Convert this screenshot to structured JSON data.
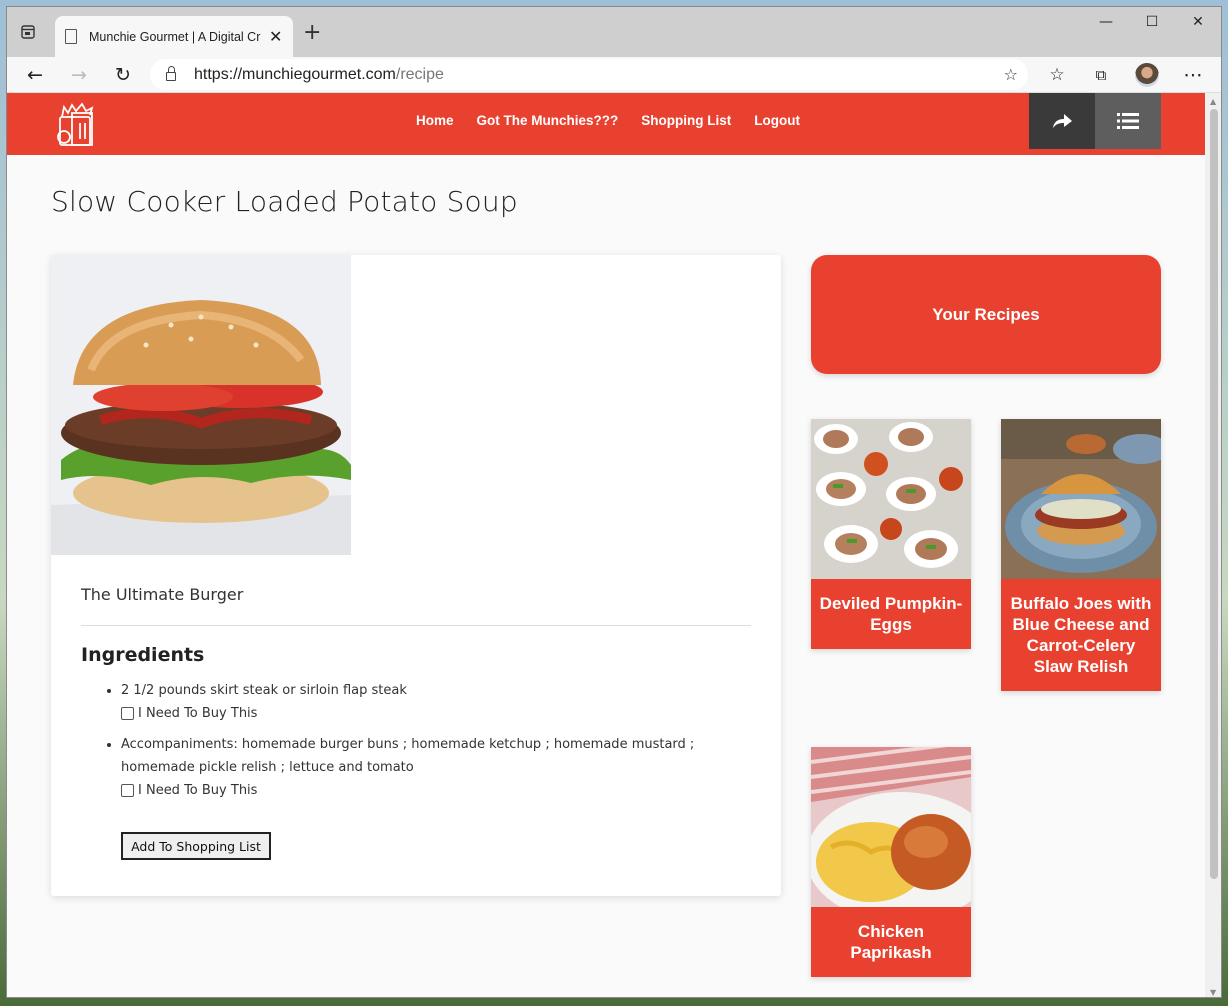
{
  "browser": {
    "tab_title": "Munchie Gourmet | A Digital Cra",
    "url_host": "https://munchiegourmet.com",
    "url_path": "/recipe"
  },
  "site": {
    "menu": [
      "Home",
      "Got The Munchies???",
      "Shopping List",
      "Logout"
    ]
  },
  "recipe": {
    "page_title": "Slow Cooker Loaded Potato Soup",
    "name": "The Ultimate Burger",
    "ingredients_heading": "Ingredients",
    "ingredients": [
      {
        "text": "2 1/2 pounds skirt steak or sirloin flap steak",
        "checkbox_label": "I Need To Buy This"
      },
      {
        "text": "Accompaniments: homemade burger buns ; homemade ketchup ; homemade mustard ; homemade pickle relish ; lettuce and tomato",
        "checkbox_label": "I Need To Buy This"
      }
    ],
    "add_button": "Add To Shopping List"
  },
  "sidebar": {
    "heading": "Your Recipes",
    "recipes": [
      "Deviled Pumpkin-Eggs",
      "Buffalo Joes with Blue Cheese and Carrot-Celery Slaw Relish",
      "Chicken Paprikash"
    ]
  },
  "colors": {
    "brand": "#e84130",
    "share_bg": "#3a3a3a",
    "list_bg": "#5e5e5e"
  },
  "icons": {
    "share": "share-arrow-icon",
    "list": "list-icon"
  }
}
